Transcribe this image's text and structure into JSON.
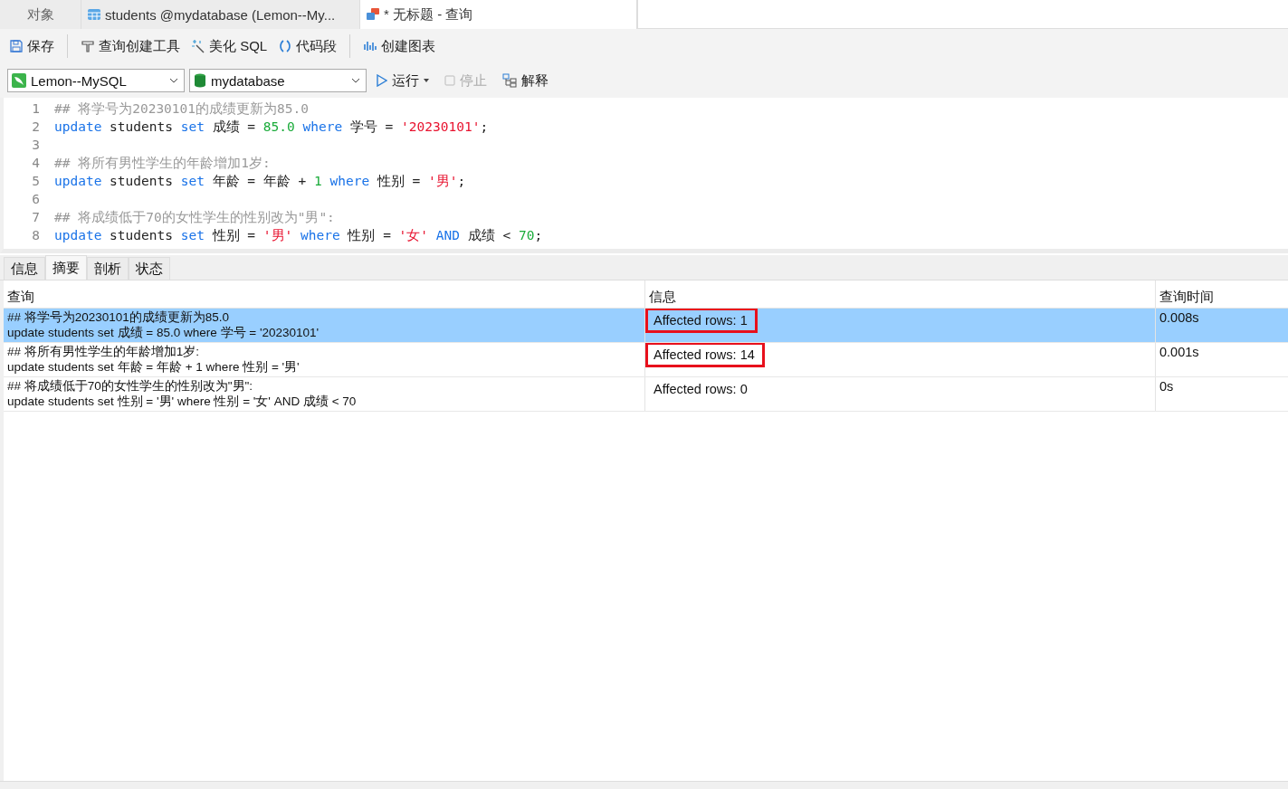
{
  "tabs": [
    {
      "label": "对象",
      "selected": false
    },
    {
      "label": "students @mydatabase (Lemon--My...",
      "selected": false
    },
    {
      "label": "* 无标题 - 查询",
      "selected": true
    }
  ],
  "toolbar": [
    {
      "label": "保存"
    },
    {
      "label": "查询创建工具"
    },
    {
      "label": "美化 SQL"
    },
    {
      "label": "代码段"
    },
    {
      "label": "创建图表"
    }
  ],
  "connection": {
    "value": "Lemon--MySQL"
  },
  "database": {
    "value": "mydatabase"
  },
  "actions": [
    {
      "label": "运行",
      "kind": "run",
      "disabled": false
    },
    {
      "label": "停止",
      "kind": "stop",
      "disabled": true
    },
    {
      "label": "解释",
      "kind": "explain",
      "disabled": false
    }
  ],
  "editor": {
    "lines": [
      {
        "number": "1",
        "tokens": [
          {
            "kind": "comment",
            "text": "## 将学号为20230101的成绩更新为85.0"
          }
        ]
      },
      {
        "number": "2",
        "tokens": [
          {
            "kind": "kw",
            "text": "update"
          },
          {
            "kind": "plain",
            "text": " students "
          },
          {
            "kind": "kw",
            "text": "set"
          },
          {
            "kind": "plain",
            "text": " 成绩 = "
          },
          {
            "kind": "num",
            "text": "85.0"
          },
          {
            "kind": "kw",
            "text": " where"
          },
          {
            "kind": "plain",
            "text": " 学号 = "
          },
          {
            "kind": "str",
            "text": "'20230101'"
          },
          {
            "kind": "plain",
            "text": ";"
          }
        ]
      },
      {
        "number": "3"
      },
      {
        "number": "4",
        "tokens": [
          {
            "kind": "comment",
            "text": "## 将所有男性学生的年龄增加1岁:"
          }
        ]
      },
      {
        "number": "5",
        "tokens": [
          {
            "kind": "kw",
            "text": "update"
          },
          {
            "kind": "plain",
            "text": " students "
          },
          {
            "kind": "kw",
            "text": "set"
          },
          {
            "kind": "plain",
            "text": " 年龄 = 年龄 + "
          },
          {
            "kind": "num",
            "text": "1"
          },
          {
            "kind": "kw",
            "text": " where"
          },
          {
            "kind": "plain",
            "text": " 性别 = "
          },
          {
            "kind": "str",
            "text": "'男'"
          },
          {
            "kind": "plain",
            "text": ";"
          }
        ]
      },
      {
        "number": "6"
      },
      {
        "number": "7",
        "tokens": [
          {
            "kind": "comment",
            "text": "## 将成绩低于70的女性学生的性别改为\"男\":"
          }
        ]
      },
      {
        "number": "8",
        "tokens": [
          {
            "kind": "kw",
            "text": "update"
          },
          {
            "kind": "plain",
            "text": " students "
          },
          {
            "kind": "kw",
            "text": "set"
          },
          {
            "kind": "plain",
            "text": " 性别 = "
          },
          {
            "kind": "str",
            "text": "'男'"
          },
          {
            "kind": "kw",
            "text": " where"
          },
          {
            "kind": "plain",
            "text": " 性别 = "
          },
          {
            "kind": "str",
            "text": "'女'"
          },
          {
            "kind": "kw",
            "text": " AND"
          },
          {
            "kind": "plain",
            "text": " 成绩 < "
          },
          {
            "kind": "num",
            "text": "70"
          },
          {
            "kind": "plain",
            "text": ";"
          }
        ]
      }
    ]
  },
  "result_tabs": [
    {
      "label": "信息",
      "selected": false
    },
    {
      "label": "摘要",
      "selected": true
    },
    {
      "label": "剖析",
      "selected": false
    },
    {
      "label": "状态",
      "selected": false
    }
  ],
  "table": {
    "columns": [
      "查询",
      "信息",
      "查询时间"
    ],
    "rows": [
      {
        "selected": true,
        "query": [
          "## 将学号为20230101的成绩更新为85.0",
          "update students set 成绩 = 85.0 where 学号 = '20230101'"
        ],
        "info": "Affected rows: 1",
        "highlighted": true,
        "time": "0.008s"
      },
      {
        "selected": false,
        "query": [
          "## 将所有男性学生的年龄增加1岁:",
          "update students set 年龄 = 年龄 + 1 where 性别 = '男'"
        ],
        "info": "Affected rows: 14",
        "highlighted": true,
        "time": "0.001s"
      },
      {
        "selected": false,
        "query": [
          "## 将成绩低于70的女性学生的性别改为\"男\":",
          "update students set 性别 = '男' where 性别 = '女' AND 成绩 < 70"
        ],
        "info": "Affected rows: 0",
        "highlighted": false,
        "time": "0s"
      }
    ]
  }
}
